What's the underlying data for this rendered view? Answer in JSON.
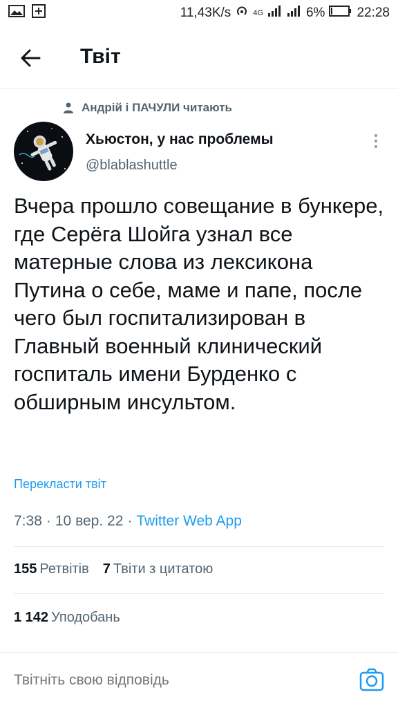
{
  "status_bar": {
    "speed": "11,43K/s",
    "network": "4G",
    "battery": "6%",
    "time": "22:28"
  },
  "header": {
    "title": "Твіт"
  },
  "tweet": {
    "social_context": "Андрій і ПАЧУЛИ читають",
    "author_name": "Хьюстон, у нас проблемы",
    "author_handle": "@blablashuttle",
    "text": "Вчера прошло совещание в бункере, где Серёга Шойга узнал все матерные слова из лексикона Путина о себе, маме и папе, после чего был госпитализирован в Главный военный клинический госпиталь имени Бурденко с обширным инсультом.",
    "translate_label": "Перекласти твіт",
    "time": "7:38",
    "date": "10 вер. 22",
    "source": "Twitter Web App",
    "separator": "·",
    "retweets_count": "155",
    "retweets_label": "Ретвітів",
    "quotes_count": "7",
    "quotes_label": "Твіти з цитатою",
    "likes_count": "1 142",
    "likes_label": "Уподобань"
  },
  "reply": {
    "placeholder": "Твітніть свою відповідь"
  },
  "colors": {
    "accent": "#1d9bf0",
    "secondary_text": "#536471",
    "divider": "#e6ecf0"
  }
}
